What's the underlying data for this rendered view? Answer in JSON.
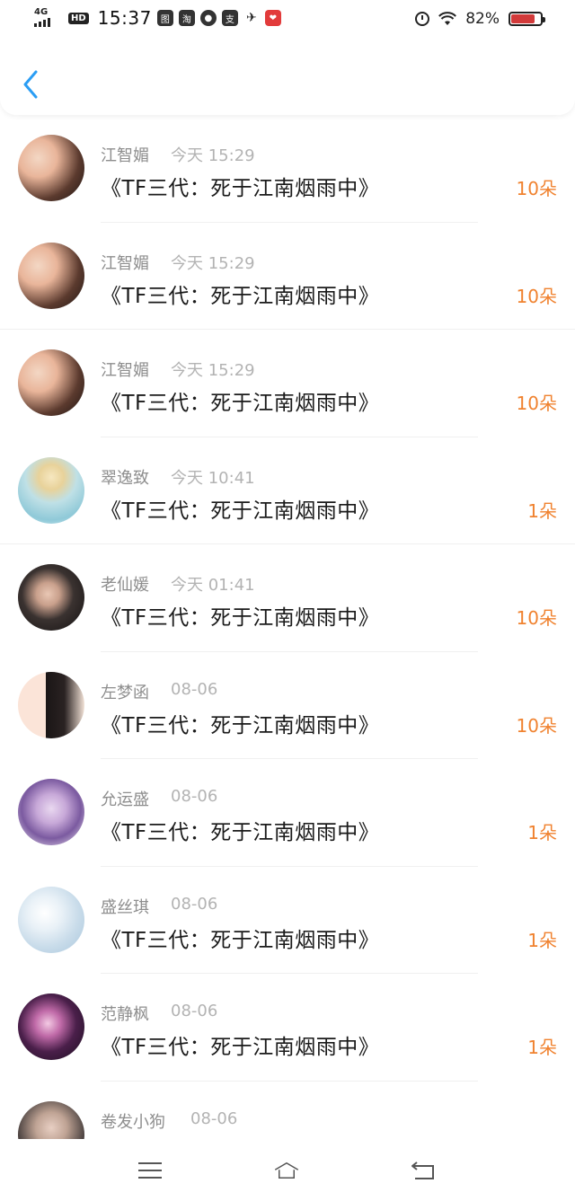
{
  "status_bar": {
    "network": "4G",
    "hd": "HD",
    "time": "15:37",
    "app_icons": [
      "图",
      "淘",
      "●",
      "支",
      "✈",
      "❤"
    ],
    "battery_percent": "82%",
    "battery_level": 0.82,
    "battery_color": "#d23a3a"
  },
  "header": {
    "back_icon": "chevron-left-icon",
    "accent": "#2a9df4"
  },
  "list": {
    "count_color": "#f0822f",
    "items": [
      {
        "name": "江智媚",
        "date": "今天 15:29",
        "title": "《TF三代：死于江南烟雨中》",
        "count": "10朵"
      },
      {
        "name": "江智媚",
        "date": "今天 15:29",
        "title": "《TF三代：死于江南烟雨中》",
        "count": "10朵"
      },
      {
        "name": "江智媚",
        "date": "今天 15:29",
        "title": "《TF三代：死于江南烟雨中》",
        "count": "10朵"
      },
      {
        "name": "翠逸致",
        "date": "今天 10:41",
        "title": "《TF三代：死于江南烟雨中》",
        "count": "1朵"
      },
      {
        "name": "老仙媛",
        "date": "今天 01:41",
        "title": "《TF三代：死于江南烟雨中》",
        "count": "10朵"
      },
      {
        "name": "左梦函",
        "date": "08-06",
        "title": "《TF三代：死于江南烟雨中》",
        "count": "10朵"
      },
      {
        "name": "允运盛",
        "date": "08-06",
        "title": "《TF三代：死于江南烟雨中》",
        "count": "1朵"
      },
      {
        "name": "盛丝琪",
        "date": "08-06",
        "title": "《TF三代：死于江南烟雨中》",
        "count": "1朵"
      },
      {
        "name": "范静枫",
        "date": "08-06",
        "title": "《TF三代：死于江南烟雨中》",
        "count": "1朵"
      },
      {
        "name": "卷发小狗",
        "date": "08-06",
        "title": "",
        "count": ""
      }
    ]
  },
  "nav_bar": {
    "icons": [
      "menu-icon",
      "home-icon",
      "back-nav-icon"
    ]
  }
}
